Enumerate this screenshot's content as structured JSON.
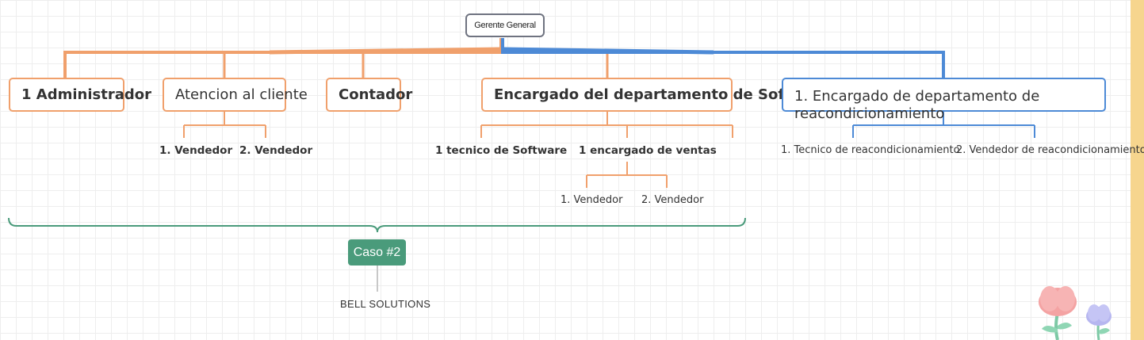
{
  "root": "Gerente General",
  "branches": {
    "admin": "1 Administrador",
    "atencion": "Atencion al cliente",
    "contador": "Contador",
    "software": "Encargado del departamento de Software",
    "reacond": "1. Encargado de departamento de reacondicionamiento"
  },
  "atencion_children": [
    "1. Vendedor",
    "2. Vendedor"
  ],
  "software_children": [
    "1 tecnico de Software",
    "1 encargado de ventas"
  ],
  "ventas_children": [
    "1. Vendedor",
    "2. Vendedor"
  ],
  "reacond_children": [
    "1. Tecnico de reacondicionamiento",
    "2. Vendedor de reacondicionamiento"
  ],
  "summary": {
    "label": "Caso #2",
    "note": "BELL SOLUTIONS"
  },
  "colors": {
    "orange": "#f0a06c",
    "blue": "#4d8ad6",
    "green": "#4a9b7b",
    "root_border": "#6f7380"
  }
}
